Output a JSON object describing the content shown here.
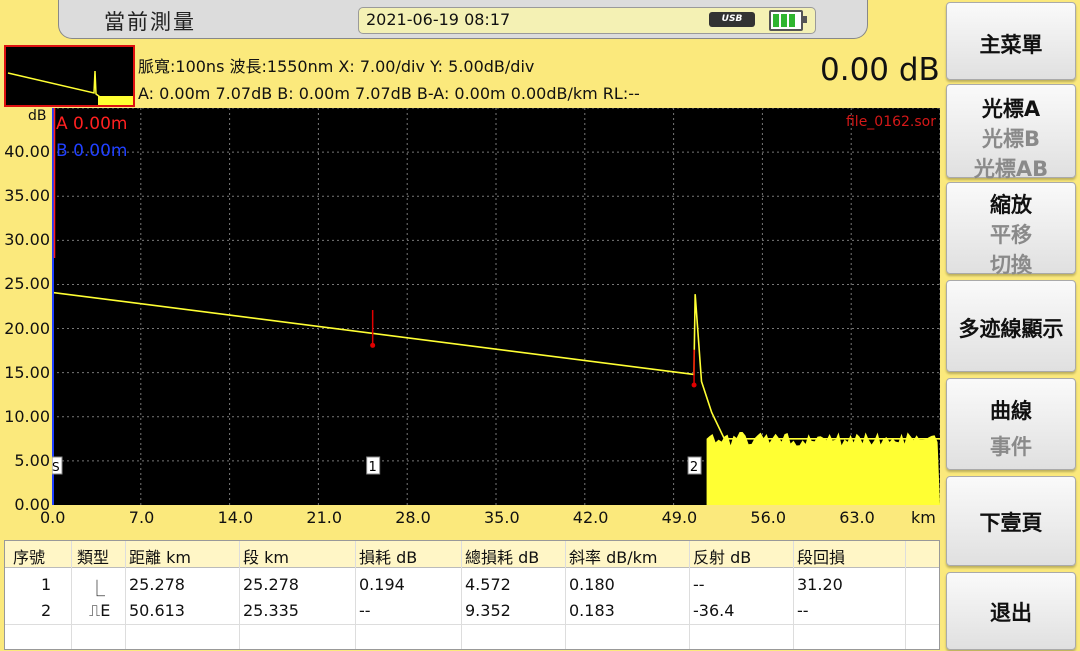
{
  "header": {
    "title": "當前測量",
    "datetime": "2021-06-19 08:17",
    "usb_label": "USB",
    "usb_icon": "usb-icon",
    "battery_icon": "battery-icon"
  },
  "info": {
    "line1": "脈寬:100ns 波長:1550nm  X: 7.00/div Y: 5.00dB/div",
    "line2": "A: 0.00m 7.07dB B: 0.00m 7.07dB B-A: 0.00m 0.00dB/km RL:--",
    "readout": "0.00 dB"
  },
  "chart_data": {
    "type": "line",
    "file_label": "file_0162.sor",
    "cursor_a_label": "A 0.00m",
    "cursor_b_label": "B 0.00m",
    "ylabel": "dB",
    "xlabel": "km",
    "x_ticks": [
      "0.0",
      "7.0",
      "14.0",
      "21.0",
      "28.0",
      "35.0",
      "42.0",
      "49.0",
      "56.0",
      "63.0"
    ],
    "y_ticks": [
      "40.00",
      "35.00",
      "30.00",
      "25.00",
      "20.00",
      "15.00",
      "10.00",
      "5.00",
      "0.00"
    ],
    "xlim": [
      0,
      70
    ],
    "ylim": [
      0,
      45
    ],
    "trace": {
      "x": [
        0,
        50.6,
        50.7,
        51.2,
        52.0,
        53.0,
        70
      ],
      "y": [
        24.1,
        14.8,
        23.9,
        14.0,
        10.5,
        7.5,
        7.5
      ]
    },
    "events": [
      {
        "label": "1",
        "x": 25.278,
        "y": 19.3
      },
      {
        "label": "2",
        "x": 50.613,
        "y": 14.8
      }
    ],
    "start_marker": "S",
    "colors": {
      "trace": "#ffff33",
      "grid": "#777777",
      "cursor_a": "#ff2020",
      "cursor_b": "#2040ff",
      "event": "#e00000"
    }
  },
  "table": {
    "headers": [
      "序號",
      "類型",
      "距離 km",
      "段 km",
      "損耗 dB",
      "總損耗 dB",
      "斜率 dB/km",
      "反射 dB",
      "段回損"
    ],
    "rows": [
      [
        "1",
        "⎿",
        "25.278",
        "25.278",
        "0.194",
        "4.572",
        "0.180",
        "--",
        "31.20"
      ],
      [
        "2",
        "⎍E",
        "50.613",
        "25.335",
        "--",
        "9.352",
        "0.183",
        "-36.4",
        "--"
      ]
    ]
  },
  "menu": {
    "main_menu": "主菜單",
    "cursor_a": "光標A",
    "cursor_b": "光標B",
    "cursor_ab": "光標AB",
    "zoom": "縮放",
    "pan": "平移",
    "toggle": "切換",
    "multi_trace": "多迹線顯示",
    "curve": "曲線",
    "event": "事件",
    "next_page": "下壹頁",
    "exit": "退出"
  }
}
